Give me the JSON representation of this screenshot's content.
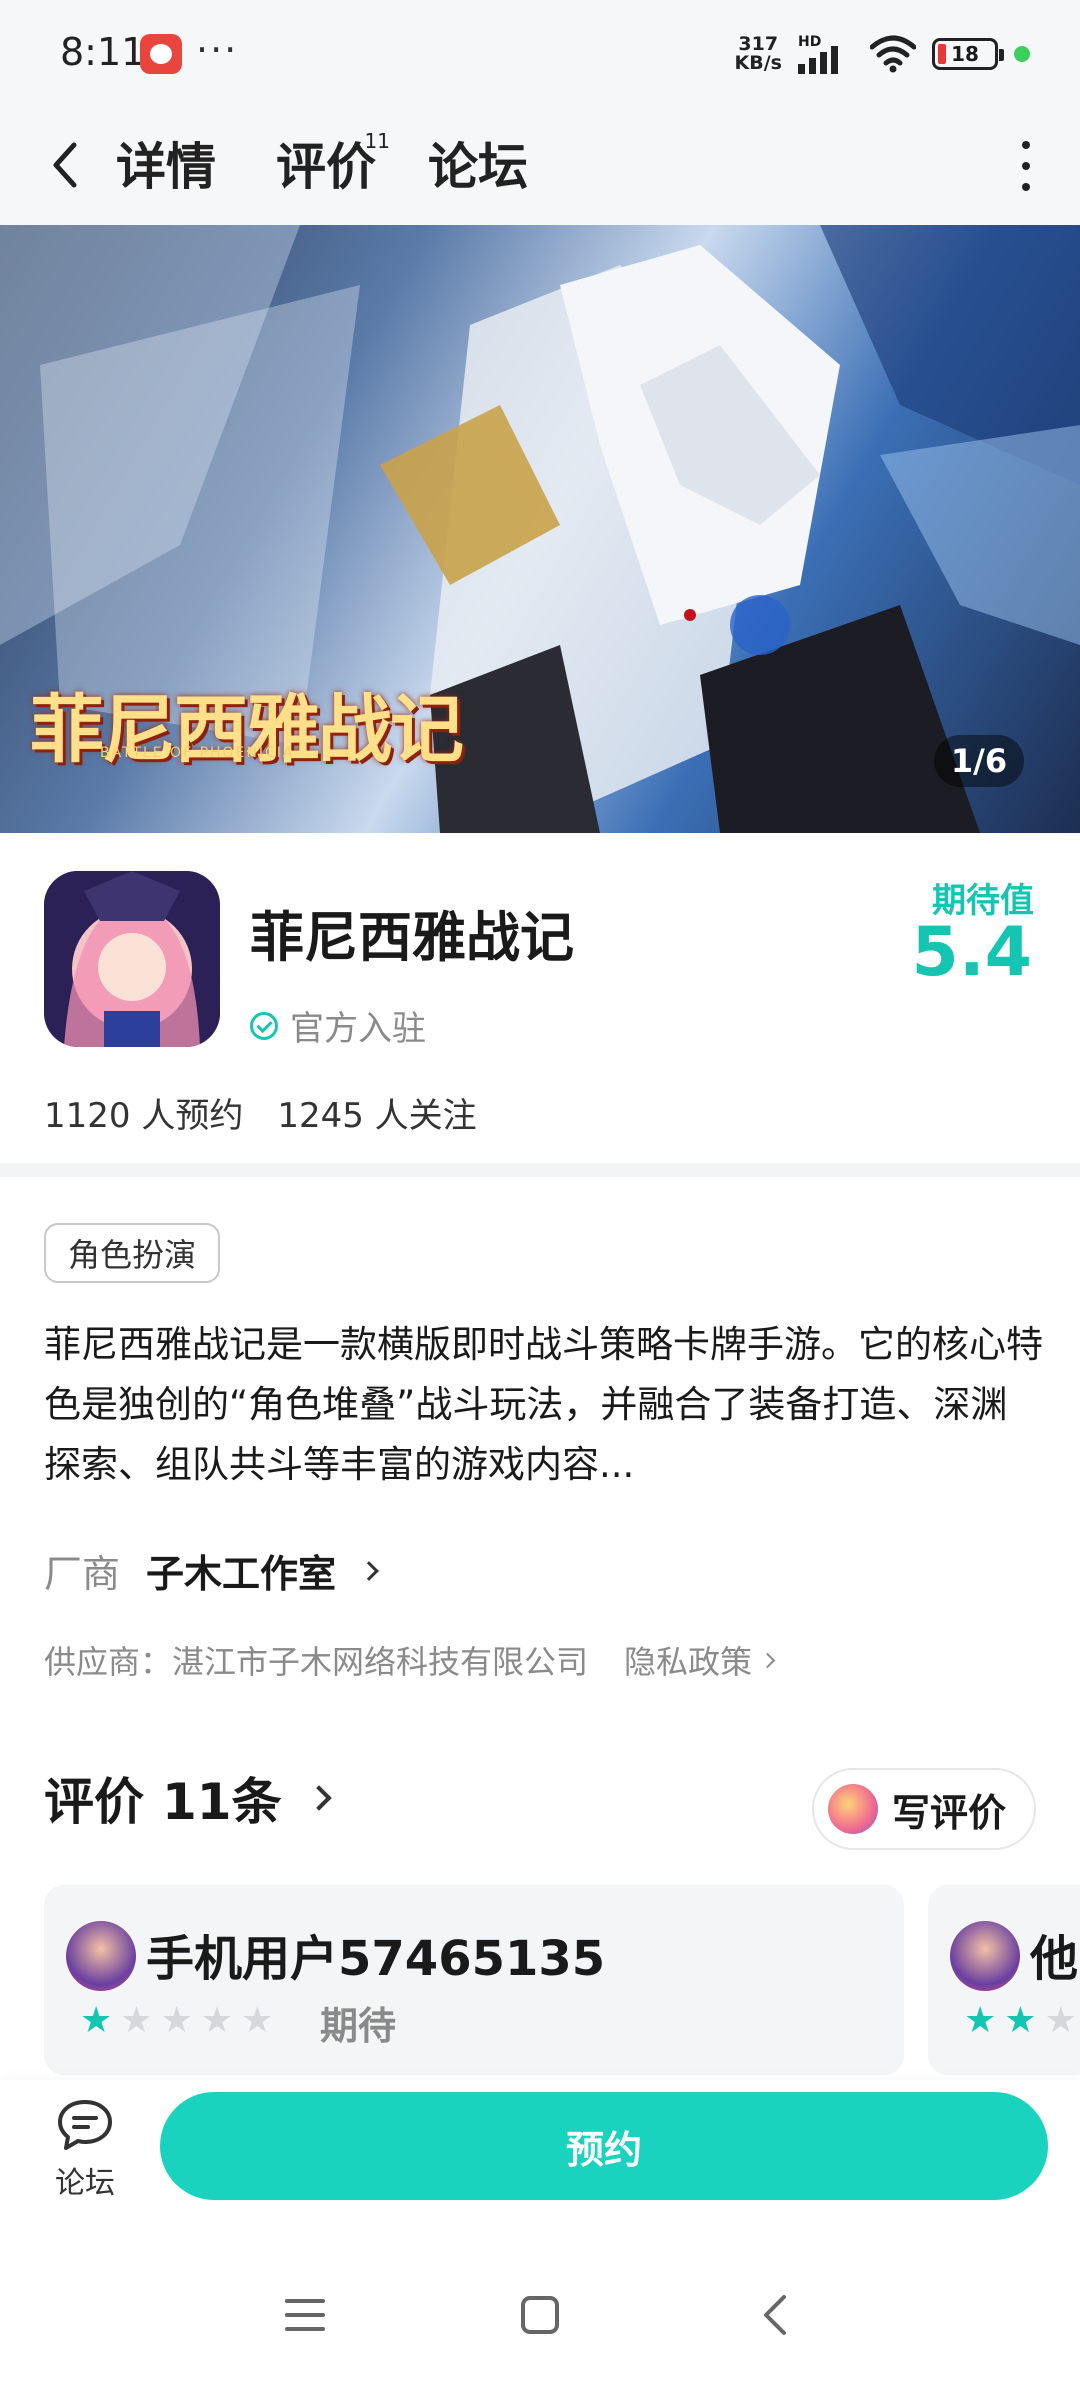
{
  "status_bar": {
    "time": "8:11",
    "dots": "···",
    "net_speed_value": "317",
    "net_speed_unit": "KB/s",
    "signal_label": "HD",
    "battery": "18"
  },
  "nav": {
    "tabs": [
      {
        "label": "详情",
        "active": true
      },
      {
        "label": "评价",
        "badge": "11"
      },
      {
        "label": "论坛"
      }
    ]
  },
  "banner": {
    "logo_text": "菲尼西雅战记",
    "logo_subtext": "BATTLE OF PHOENICIA",
    "counter": "1/6"
  },
  "app": {
    "name": "菲尼西雅战记",
    "verified_label": "官方入驻",
    "expect_label": "期待值",
    "expect_score": "5.4",
    "reservations": "1120 人预约",
    "followers": "1245 人关注"
  },
  "details": {
    "genre_tag": "角色扮演",
    "description": "菲尼西雅战记是一款横版即时战斗策略卡牌手游。它的核心特色是独创的“角色堆叠”战斗玩法，并融合了装备打造、深渊探索、组队共斗等丰富的游戏内容...",
    "developer_label": "厂商",
    "developer_name": "子木工作室",
    "supplier": "供应商：湛江市子木网络科技有限公司",
    "privacy_label": "隐私政策"
  },
  "reviews": {
    "title": "评价",
    "count": "11条",
    "write_label": "写评价",
    "cards": [
      {
        "user": "手机用户57465135",
        "stars": 1,
        "max_stars": 5,
        "label": "期待"
      },
      {
        "user": "他",
        "stars": 2,
        "max_stars": 5
      }
    ]
  },
  "action_bar": {
    "forum_label": "论坛",
    "reserve_label": "预约"
  },
  "colors": {
    "accent": "#15c5b2",
    "button": "#1ad3bf",
    "text": "#1a1a1a",
    "muted": "#8a8a8a"
  },
  "icons": {
    "back": "back-chevron-icon",
    "more": "more-vertical-icon",
    "wifi": "wifi-icon",
    "battery": "battery-icon",
    "verified": "verified-check-icon",
    "forum": "forum-chat-icon"
  }
}
